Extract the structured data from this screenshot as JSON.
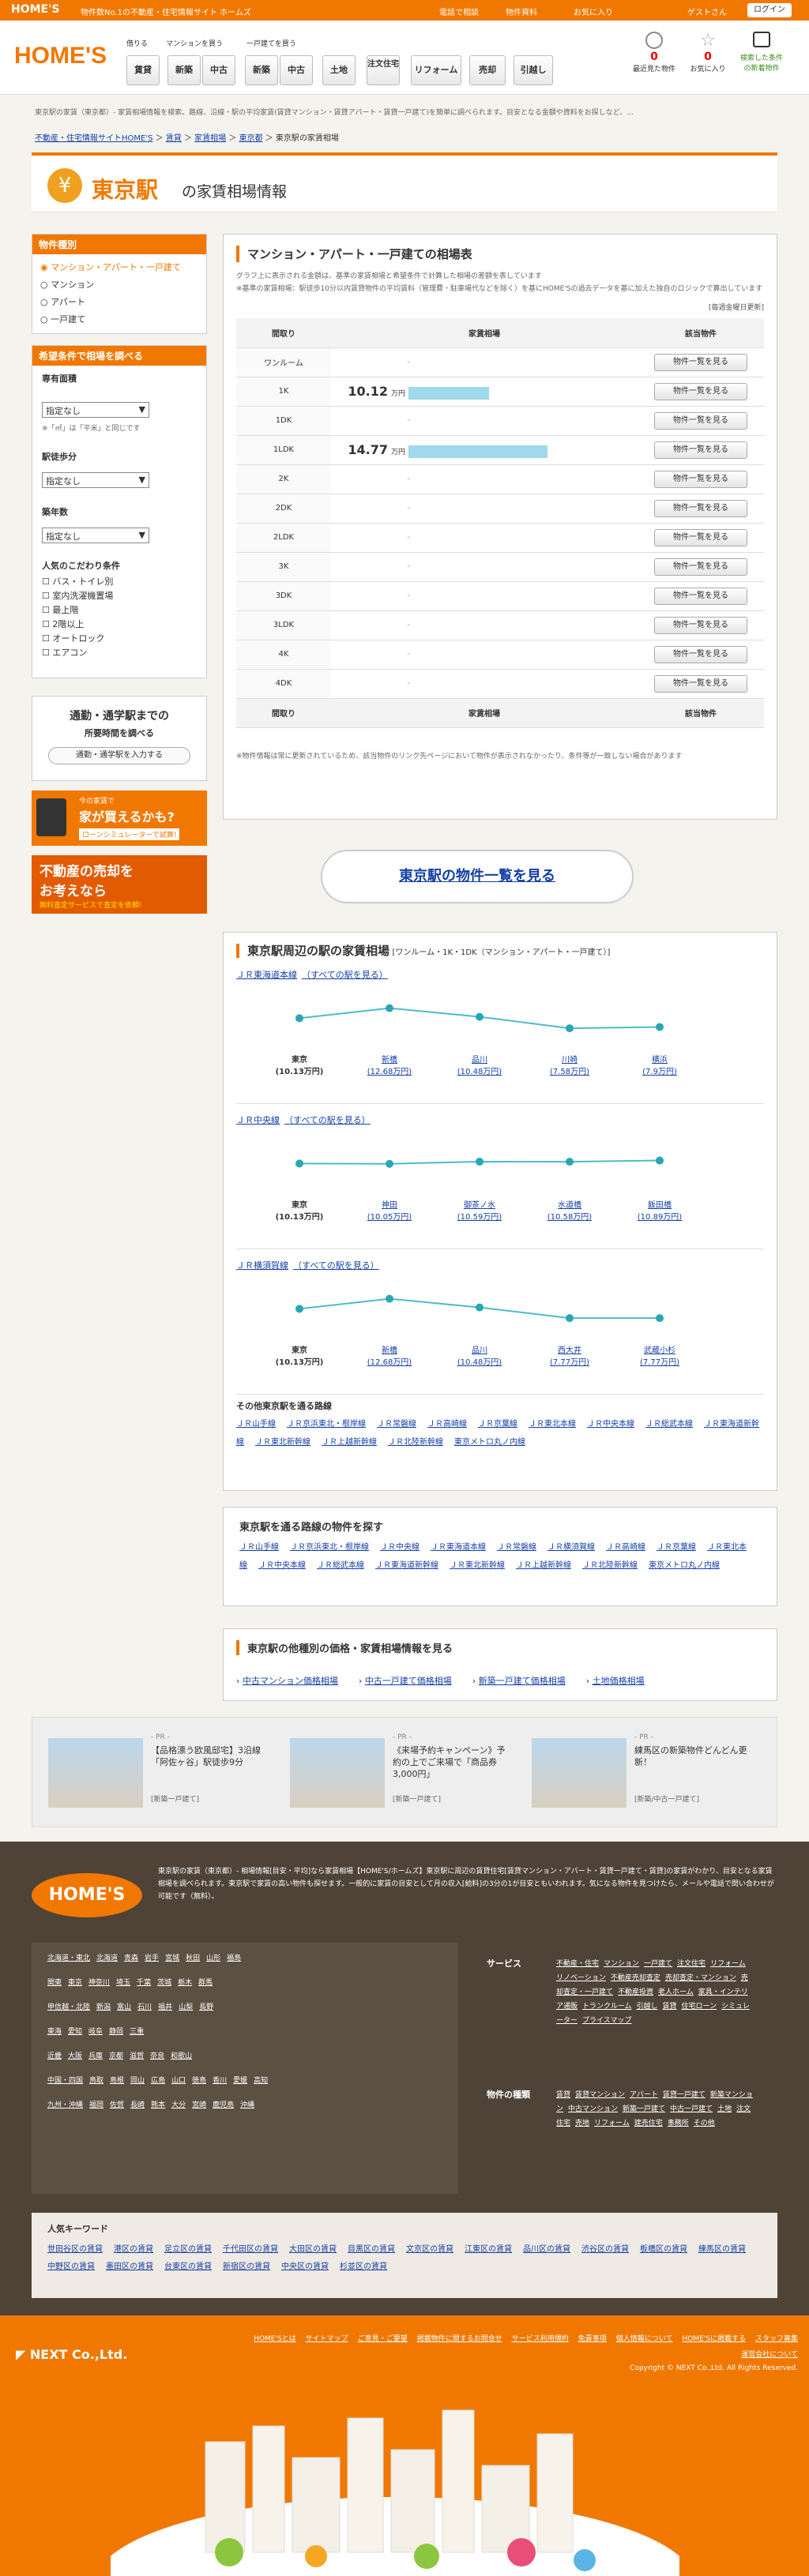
{
  "topbar": {
    "logo": "HOME'S",
    "tagline": "物件数No.1の不動産・住宅情報サイト ホームズ",
    "links": [
      "電話で相談",
      "物件資料",
      "お気に入り",
      "ゲストさん"
    ],
    "login": "ログイン"
  },
  "header": {
    "logo": "HOME'S",
    "categories": [
      "借りる",
      "マンションを買う",
      "一戸建てを買う"
    ],
    "nav": [
      "賃貸",
      "新築",
      "中古",
      "新築",
      "中古",
      "土地",
      "注文住宅",
      "リフォーム",
      "売却",
      "引越し"
    ],
    "icons": [
      {
        "label": "最近見た物件",
        "count": "0"
      },
      {
        "label": "お気に入り",
        "count": "0"
      },
      {
        "label": "検索した条件の新着物件",
        "count": ""
      }
    ]
  },
  "description": "東京駅の家賃（東京都）- 家賃相場情報を検索。路線、沿線・駅の平均家賃(賃貸マンション・賃貸アパート・賃貸一戸建て)を簡単に調べられます。目安となる金額や資料をお探しなど、...",
  "breadcrumb": [
    "不動産・住宅情報サイトHOME'S",
    "賃貸",
    "家賃相場",
    "東京都",
    "東京駅の家賃相場"
  ],
  "title": {
    "station": "東京駅",
    "rest": "の家賃相場情報"
  },
  "sidebar": {
    "type_head": "物件種別",
    "types": [
      "マンション・アパート・一戸建て",
      "マンション",
      "アパート",
      "一戸建て"
    ],
    "cond_head": "希望条件で相場を調べる",
    "madori_label": "専有面積",
    "select_default": "指定なし",
    "note": "※「㎡」は「平米」と同じです",
    "walk_label": "駅徒歩分",
    "age_label": "築年数",
    "kodawari_label": "人気のこだわり条件",
    "kodawari": [
      "バス・トイレ別",
      "室内洗濯機置場",
      "最上階",
      "2階以上",
      "オートロック",
      "エアコン"
    ],
    "commute_title": "通勤・通学駅までの",
    "commute_sub": "所要時間を調べる",
    "commute_btn": "通勤・通学駅を入力する",
    "loan_small": "今の家賃で",
    "loan_big": "家が買えるかも?",
    "loan_btn": "ローンシミュレーターで試算!",
    "sell_big1": "不動産の売却を",
    "sell_big2": "お考えなら",
    "sell_small": "無料査定サービスで査定を依頼!"
  },
  "rent": {
    "title": "マンション・アパート・一戸建ての相場表",
    "note": "グラフ上に表示される金額は、基準の家賃相場と希望条件で計算した相場の差額を表しています\n※基準の家賃相場：駅徒歩10分以内賃貸物件の平均賃料（管理費・駐車場代などを除く）を基にHOME'Sの過去データを基に加えた独自のロジックで算出しています",
    "updated": "[毎週金曜日更新]",
    "columns": [
      "間取り",
      "家賃相場",
      "該当物件"
    ],
    "unit": "万円",
    "rows": [
      {
        "madori": "ワンルーム",
        "rent": "",
        "view": "物件一覧を見る"
      },
      {
        "madori": "1K",
        "rent": "10.12",
        "view": "物件一覧を見る"
      },
      {
        "madori": "1DK",
        "rent": "",
        "view": "物件一覧を見る"
      },
      {
        "madori": "1LDK",
        "rent": "14.77",
        "view": "物件一覧を見る"
      },
      {
        "madori": "2K",
        "rent": "",
        "view": "物件一覧を見る"
      },
      {
        "madori": "2DK",
        "rent": "",
        "view": "物件一覧を見る"
      },
      {
        "madori": "2LDK",
        "rent": "",
        "view": "物件一覧を見る"
      },
      {
        "madori": "3K",
        "rent": "",
        "view": "物件一覧を見る"
      },
      {
        "madori": "3DK",
        "rent": "",
        "view": "物件一覧を見る"
      },
      {
        "madori": "3LDK",
        "rent": "",
        "view": "物件一覧を見る"
      },
      {
        "madori": "4K",
        "rent": "",
        "view": "物件一覧を見る"
      },
      {
        "madori": "4DK",
        "rent": "",
        "view": "物件一覧を見る"
      }
    ],
    "footnote": "※物件情報は常に更新されているため、該当物件のリンク先ページにおいて物件が表示されなかったり、条件等が一致しない場合があります",
    "more": "東京駅の物件一覧を見る"
  },
  "nearby": {
    "title": "東京駅周辺の駅の家賃相場",
    "subtitle": "[ワンルーム・1K・1DK（マンション・アパート・一戸建て）]",
    "all_stations": "（すべての駅を見る）",
    "lines": [
      {
        "name": "ＪＲ東海道本線",
        "stations": [
          {
            "name": "東京",
            "price": "(10.13万円)"
          },
          {
            "name": "新橋",
            "price": "(12.68万円)"
          },
          {
            "name": "品川",
            "price": "(10.48万円)"
          },
          {
            "name": "川崎",
            "price": "(7.58万円)"
          },
          {
            "name": "横浜",
            "price": "(7.9万円)"
          }
        ]
      },
      {
        "name": "ＪＲ中央線",
        "stations": [
          {
            "name": "東京",
            "price": "(10.13万円)"
          },
          {
            "name": "神田",
            "price": "(10.05万円)"
          },
          {
            "name": "御茶ノ水",
            "price": "(10.59万円)"
          },
          {
            "name": "水道橋",
            "price": "(10.58万円)"
          },
          {
            "name": "飯田橋",
            "price": "(10.89万円)"
          }
        ]
      },
      {
        "name": "ＪＲ横須賀線",
        "stations": [
          {
            "name": "東京",
            "price": "(10.13万円)"
          },
          {
            "name": "新橋",
            "price": "(12.68万円)"
          },
          {
            "name": "品川",
            "price": "(10.48万円)"
          },
          {
            "name": "西大井",
            "price": "(7.77万円)"
          },
          {
            "name": "武蔵小杉",
            "price": "(7.77万円)"
          }
        ]
      }
    ],
    "other_title": "その他東京駅を通る路線",
    "other_lines": [
      "ＪＲ山手線",
      "ＪＲ京浜東北・根岸線",
      "ＪＲ常磐線",
      "ＪＲ高崎線",
      "ＪＲ京葉線",
      "ＪＲ東北本線",
      "ＪＲ中央本線",
      "ＪＲ総武本線",
      "ＪＲ東海道新幹線",
      "ＪＲ東北新幹線",
      "ＪＲ上越新幹線",
      "ＪＲ北陸新幹線",
      "東京メトロ丸ノ内線"
    ]
  },
  "search_lines": {
    "title": "東京駅を通る路線の物件を探す",
    "lines": [
      "ＪＲ山手線",
      "ＪＲ京浜東北・根岸線",
      "ＪＲ中央線",
      "ＪＲ東海道本線",
      "ＪＲ常磐線",
      "ＪＲ横須賀線",
      "ＪＲ高崎線",
      "ＪＲ京葉線",
      "ＪＲ東北本線",
      "ＪＲ中央本線",
      "ＪＲ総武本線",
      "ＪＲ東海道新幹線",
      "ＪＲ東北新幹線",
      "ＪＲ上越新幹線",
      "ＪＲ北陸新幹線",
      "東京メトロ丸ノ内線"
    ]
  },
  "other_types": {
    "title": "東京駅の他種別の価格・家賃相場情報を見る",
    "links": [
      "中古マンション価格相場",
      "中古一戸建て価格相場",
      "新築一戸建て価格相場",
      "土地価格相場"
    ]
  },
  "pr": [
    {
      "tag": "- PR -",
      "text": "【品格漂う欧風邸宅】3沿線「阿佐ヶ谷」駅徒歩9分",
      "sub": "[新築一戸建て]"
    },
    {
      "tag": "- PR -",
      "text": "《来場予約キャンペーン》予約の上でご来場で「商品券3,000円」",
      "sub": "[新築一戸建て]"
    },
    {
      "tag": "- PR -",
      "text": "練馬区の新築物件どんどん更新！",
      "sub": "[新築/中古一戸建て]"
    }
  ],
  "footer": {
    "logo": "HOME'S",
    "about": "東京駅の家賃（東京都）- 相場情報[目安・平均]なら家賃相場【HOME'S/ホームズ】東京駅に周辺の賃貸住宅[賃貸マンション・アパート・賃貸一戸建て・賃貸]の家賃がわかり、目安となる家賃相場を調べられます。東京駅で家賃の高い物件も探せます。一般的に家賃の目安として月の収入[給料]の3分の1が目安ともいわれます。気になる物件を見つけたら、メールや電話で問い合わせが可能です（無料）。",
    "prefs": [
      [
        "北海道・東北",
        "北海道",
        "青森",
        "岩手",
        "宮城",
        "秋田",
        "山形",
        "福島"
      ],
      [
        "関東",
        "東京",
        "神奈川",
        "埼玉",
        "千葉",
        "茨城",
        "栃木",
        "群馬"
      ],
      [
        "甲信越・北陸",
        "新潟",
        "富山",
        "石川",
        "福井",
        "山梨",
        "長野"
      ],
      [
        "東海",
        "愛知",
        "岐阜",
        "静岡",
        "三重"
      ],
      [
        "近畿",
        "大阪",
        "兵庫",
        "京都",
        "滋賀",
        "奈良",
        "和歌山"
      ],
      [
        "中国・四国",
        "鳥取",
        "島根",
        "岡山",
        "広島",
        "山口",
        "徳島",
        "香川",
        "愛媛",
        "高知"
      ],
      [
        "九州・沖縄",
        "福岡",
        "佐賀",
        "長崎",
        "熊本",
        "大分",
        "宮崎",
        "鹿児島",
        "沖縄"
      ]
    ],
    "service_label": "サービス",
    "services": [
      "不動産・住宅",
      "マンション",
      "一戸建て",
      "注文住宅",
      "リフォーム",
      "リノベーション",
      "不動産売却査定",
      "売却査定・マンション",
      "売却査定・一戸建て",
      "不動産投資",
      "老人ホーム",
      "家具・インテリア通販",
      "トランクルーム",
      "引越し",
      "賃貸",
      "住宅ローン",
      "シミュレーター",
      "プライスマップ"
    ],
    "type_label": "物件の種類",
    "types": [
      "賃貸",
      "賃貸マンション",
      "アパート",
      "賃貸一戸建て",
      "新築マンション",
      "中古マンション",
      "新築一戸建て",
      "中古一戸建て",
      "土地",
      "注文住宅",
      "売地",
      "リフォーム",
      "建売住宅",
      "事務所",
      "その他"
    ],
    "kw_label": "人気キーワード",
    "keywords": [
      "世田谷区の賃貸",
      "港区の賃貸",
      "足立区の賃貸",
      "千代田区の賃貸",
      "大田区の賃貸",
      "目黒区の賃貸",
      "文京区の賃貸",
      "江東区の賃貸",
      "品川区の賃貸",
      "渋谷区の賃貸",
      "板橋区の賃貸",
      "練馬区の賃貸",
      "中野区の賃貸",
      "墨田区の賃貸",
      "台東区の賃貸",
      "新宿区の賃貸",
      "中央区の賃貸",
      "杉並区の賃貸"
    ]
  },
  "bottom": {
    "company": "NEXT Co.,Ltd.",
    "links": [
      "HOME'Sとは",
      "サイトマップ",
      "ご意見・ご要望",
      "掲載物件に関するお問合せ",
      "サービス利用規約",
      "免責事項",
      "個人情報について",
      "HOME'Sに掲載する",
      "スタッフ募集",
      "運営会社について"
    ],
    "copyright": "Copyright © NEXT Co.,Ltd. All Rights Reserved."
  }
}
